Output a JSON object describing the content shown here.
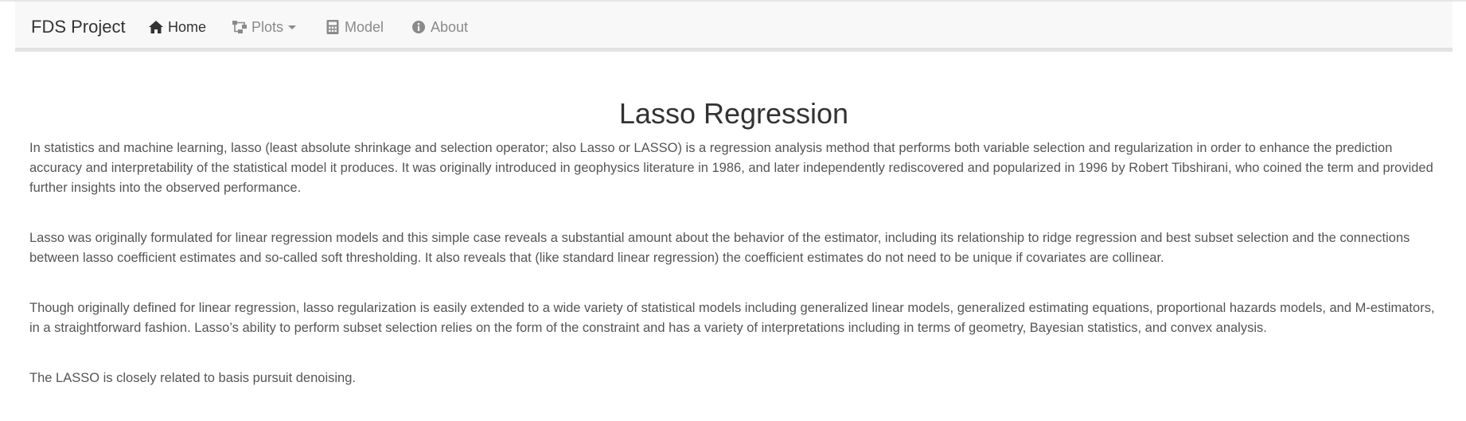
{
  "navbar": {
    "brand": "FDS Project",
    "items": [
      {
        "label": "Home",
        "icon": "home-icon",
        "active": true
      },
      {
        "label": "Plots",
        "icon": "sitemap-icon",
        "dropdown": true
      },
      {
        "label": "Model",
        "icon": "calculator-icon"
      },
      {
        "label": "About",
        "icon": "info-circle-icon"
      }
    ]
  },
  "main": {
    "title": "Lasso Regression",
    "paragraphs": [
      "In statistics and machine learning, lasso (least absolute shrinkage and selection operator; also Lasso or LASSO) is a regression analysis method that performs both variable selection and regularization in order to enhance the prediction accuracy and interpretability of the statistical model it produces. It was originally introduced in geophysics literature in 1986, and later independently rediscovered and popularized in 1996 by Robert Tibshirani, who coined the term and provided further insights into the observed performance.",
      "Lasso was originally formulated for linear regression models and this simple case reveals a substantial amount about the behavior of the estimator, including its relationship to ridge regression and best subset selection and the connections between lasso coefficient estimates and so-called soft thresholding. It also reveals that (like standard linear regression) the coefficient estimates do not need to be unique if covariates are collinear.",
      "Though originally defined for linear regression, lasso regularization is easily extended to a wide variety of statistical models including generalized linear models, generalized estimating equations, proportional hazards models, and M-estimators, in a straightforward fashion. Lasso’s ability to perform subset selection relies on the form of the constraint and has a variety of interpretations including in terms of geometry, Bayesian statistics, and convex analysis.",
      "The LASSO is closely related to basis pursuit denoising."
    ]
  },
  "colors": {
    "navbar_bg": "#f8f8f8",
    "nav_active": "#333333",
    "nav_inactive": "#8a8a8a",
    "body_text": "#555555"
  }
}
